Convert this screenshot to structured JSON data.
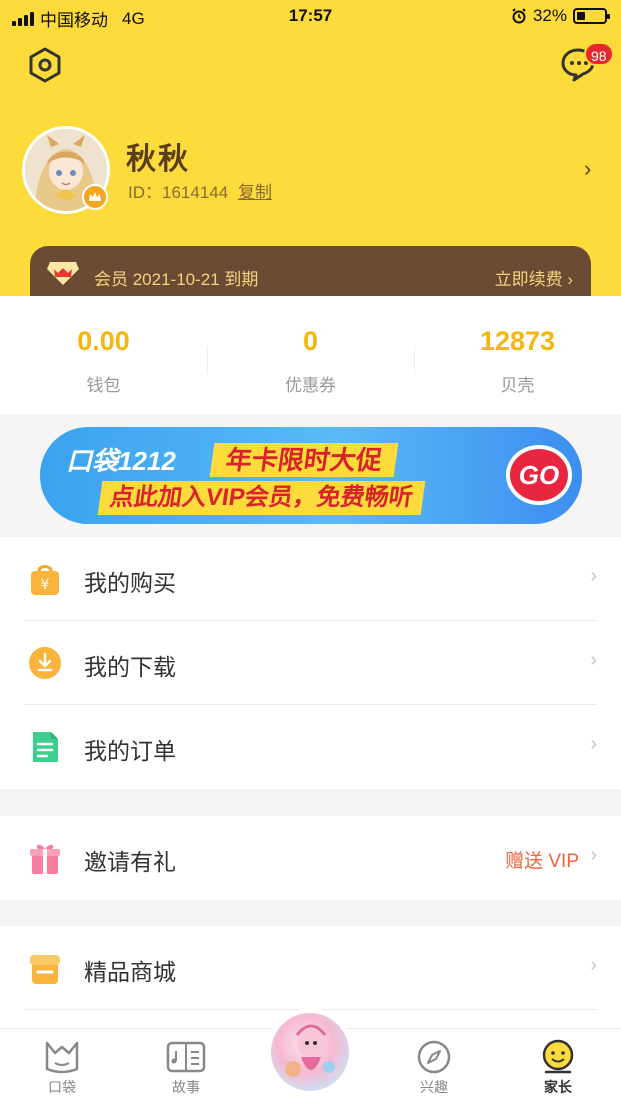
{
  "status_bar": {
    "carrier": "中国移动",
    "network": "4G",
    "time": "17:57",
    "battery": "32%",
    "battery_level": 0.32
  },
  "header": {
    "message_badge": "98",
    "user": {
      "name": "秋秋",
      "id_label": "ID：1614144",
      "copy_label": "复制"
    },
    "vip": {
      "text": "会员 2021-10-21 到期",
      "renew_label": "立即续费 ›"
    }
  },
  "stats": [
    {
      "value": "0.00",
      "label": "钱包"
    },
    {
      "value": "0",
      "label": "优惠券"
    },
    {
      "value": "12873",
      "label": "贝壳"
    }
  ],
  "banner": {
    "brand": "口袋1212",
    "line1": "年卡限时大促",
    "line2": "点此加入VIP会员，免费畅听",
    "cta": "GO"
  },
  "menu": {
    "group1": [
      {
        "label": "我的购买",
        "icon": "shopping-bag-icon",
        "chevron": "›"
      },
      {
        "label": "我的下载",
        "icon": "download-icon",
        "chevron": "›"
      },
      {
        "label": "我的订单",
        "icon": "order-document-icon",
        "chevron": "›"
      }
    ],
    "group2": [
      {
        "label": "邀请有礼",
        "icon": "gift-icon",
        "extra": "赠送 VIP",
        "chevron": "›"
      }
    ],
    "group3": [
      {
        "label": "精品商城",
        "icon": "store-icon",
        "chevron": "›"
      }
    ]
  },
  "tabbar": {
    "tabs": [
      {
        "label": "口袋",
        "icon": "pocket-icon"
      },
      {
        "label": "故事",
        "icon": "story-icon"
      },
      {
        "label": "兴趣",
        "icon": "compass-icon"
      },
      {
        "label": "家长",
        "icon": "parent-icon"
      }
    ],
    "active": "家长"
  },
  "colors": {
    "header_bg": "#fddb3a",
    "accent": "#f5b70f",
    "vip_bar": "#6b4a33",
    "badge": "#e8262d",
    "highlight": "#f0653d"
  }
}
